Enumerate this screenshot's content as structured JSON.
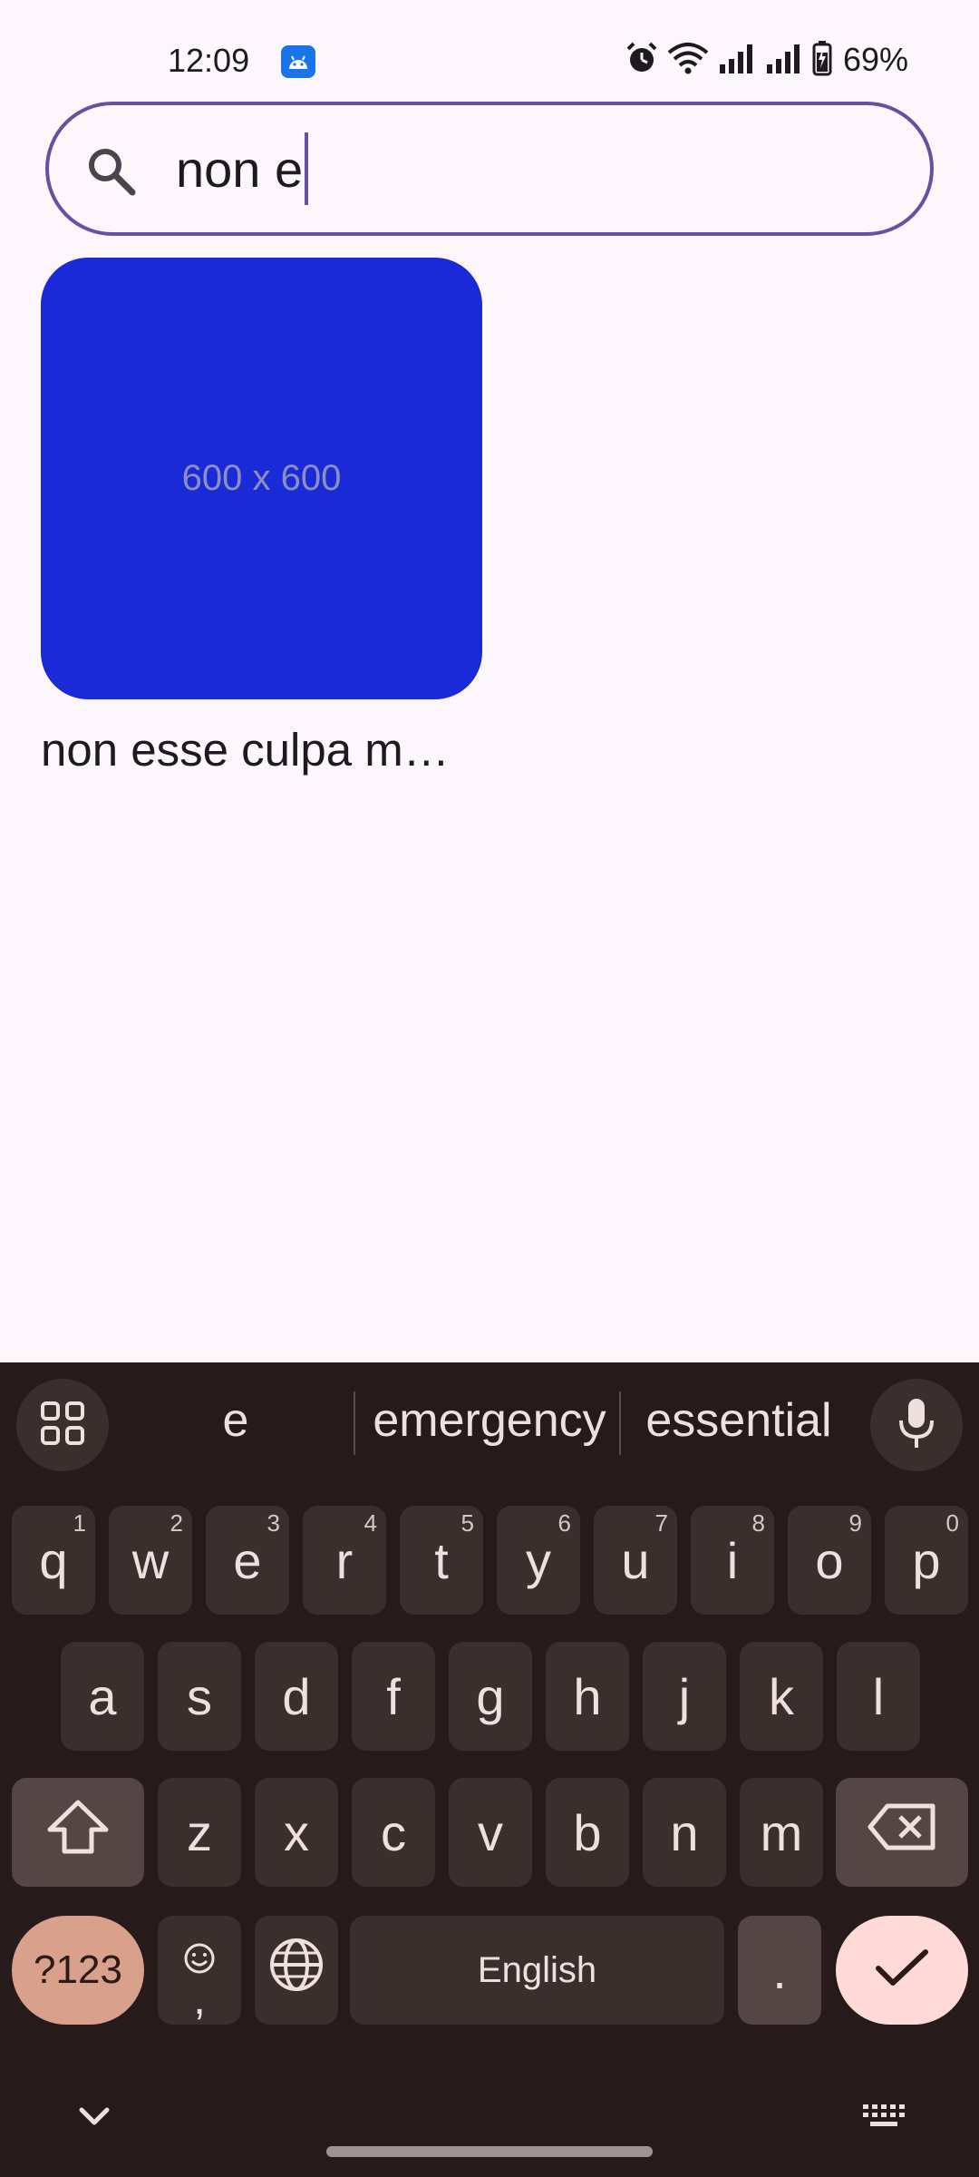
{
  "status_bar": {
    "time": "12:09",
    "battery": "69%",
    "icons": [
      "android-app-icon",
      "alarm-icon",
      "wifi-icon",
      "signal-icon",
      "signal-icon",
      "battery-charging-icon"
    ]
  },
  "search": {
    "value": "non e",
    "icon": "search-icon"
  },
  "results": [
    {
      "thumbnail_label": "600 x 600",
      "thumbnail_color": "#1a2ad6",
      "title": "non esse culpa m…"
    }
  ],
  "keyboard": {
    "suggestions": [
      "e",
      "emergency",
      "essential"
    ],
    "row1": [
      {
        "key": "q",
        "hint": "1"
      },
      {
        "key": "w",
        "hint": "2"
      },
      {
        "key": "e",
        "hint": "3"
      },
      {
        "key": "r",
        "hint": "4"
      },
      {
        "key": "t",
        "hint": "5"
      },
      {
        "key": "y",
        "hint": "6"
      },
      {
        "key": "u",
        "hint": "7"
      },
      {
        "key": "i",
        "hint": "8"
      },
      {
        "key": "o",
        "hint": "9"
      },
      {
        "key": "p",
        "hint": "0"
      }
    ],
    "row2": [
      "a",
      "s",
      "d",
      "f",
      "g",
      "h",
      "j",
      "k",
      "l"
    ],
    "row3": [
      "z",
      "x",
      "c",
      "v",
      "b",
      "n",
      "m"
    ],
    "symbols_label": "?123",
    "emoji_comma": ",",
    "space_label": "English",
    "period": ".",
    "accent": "#ffdad6"
  }
}
